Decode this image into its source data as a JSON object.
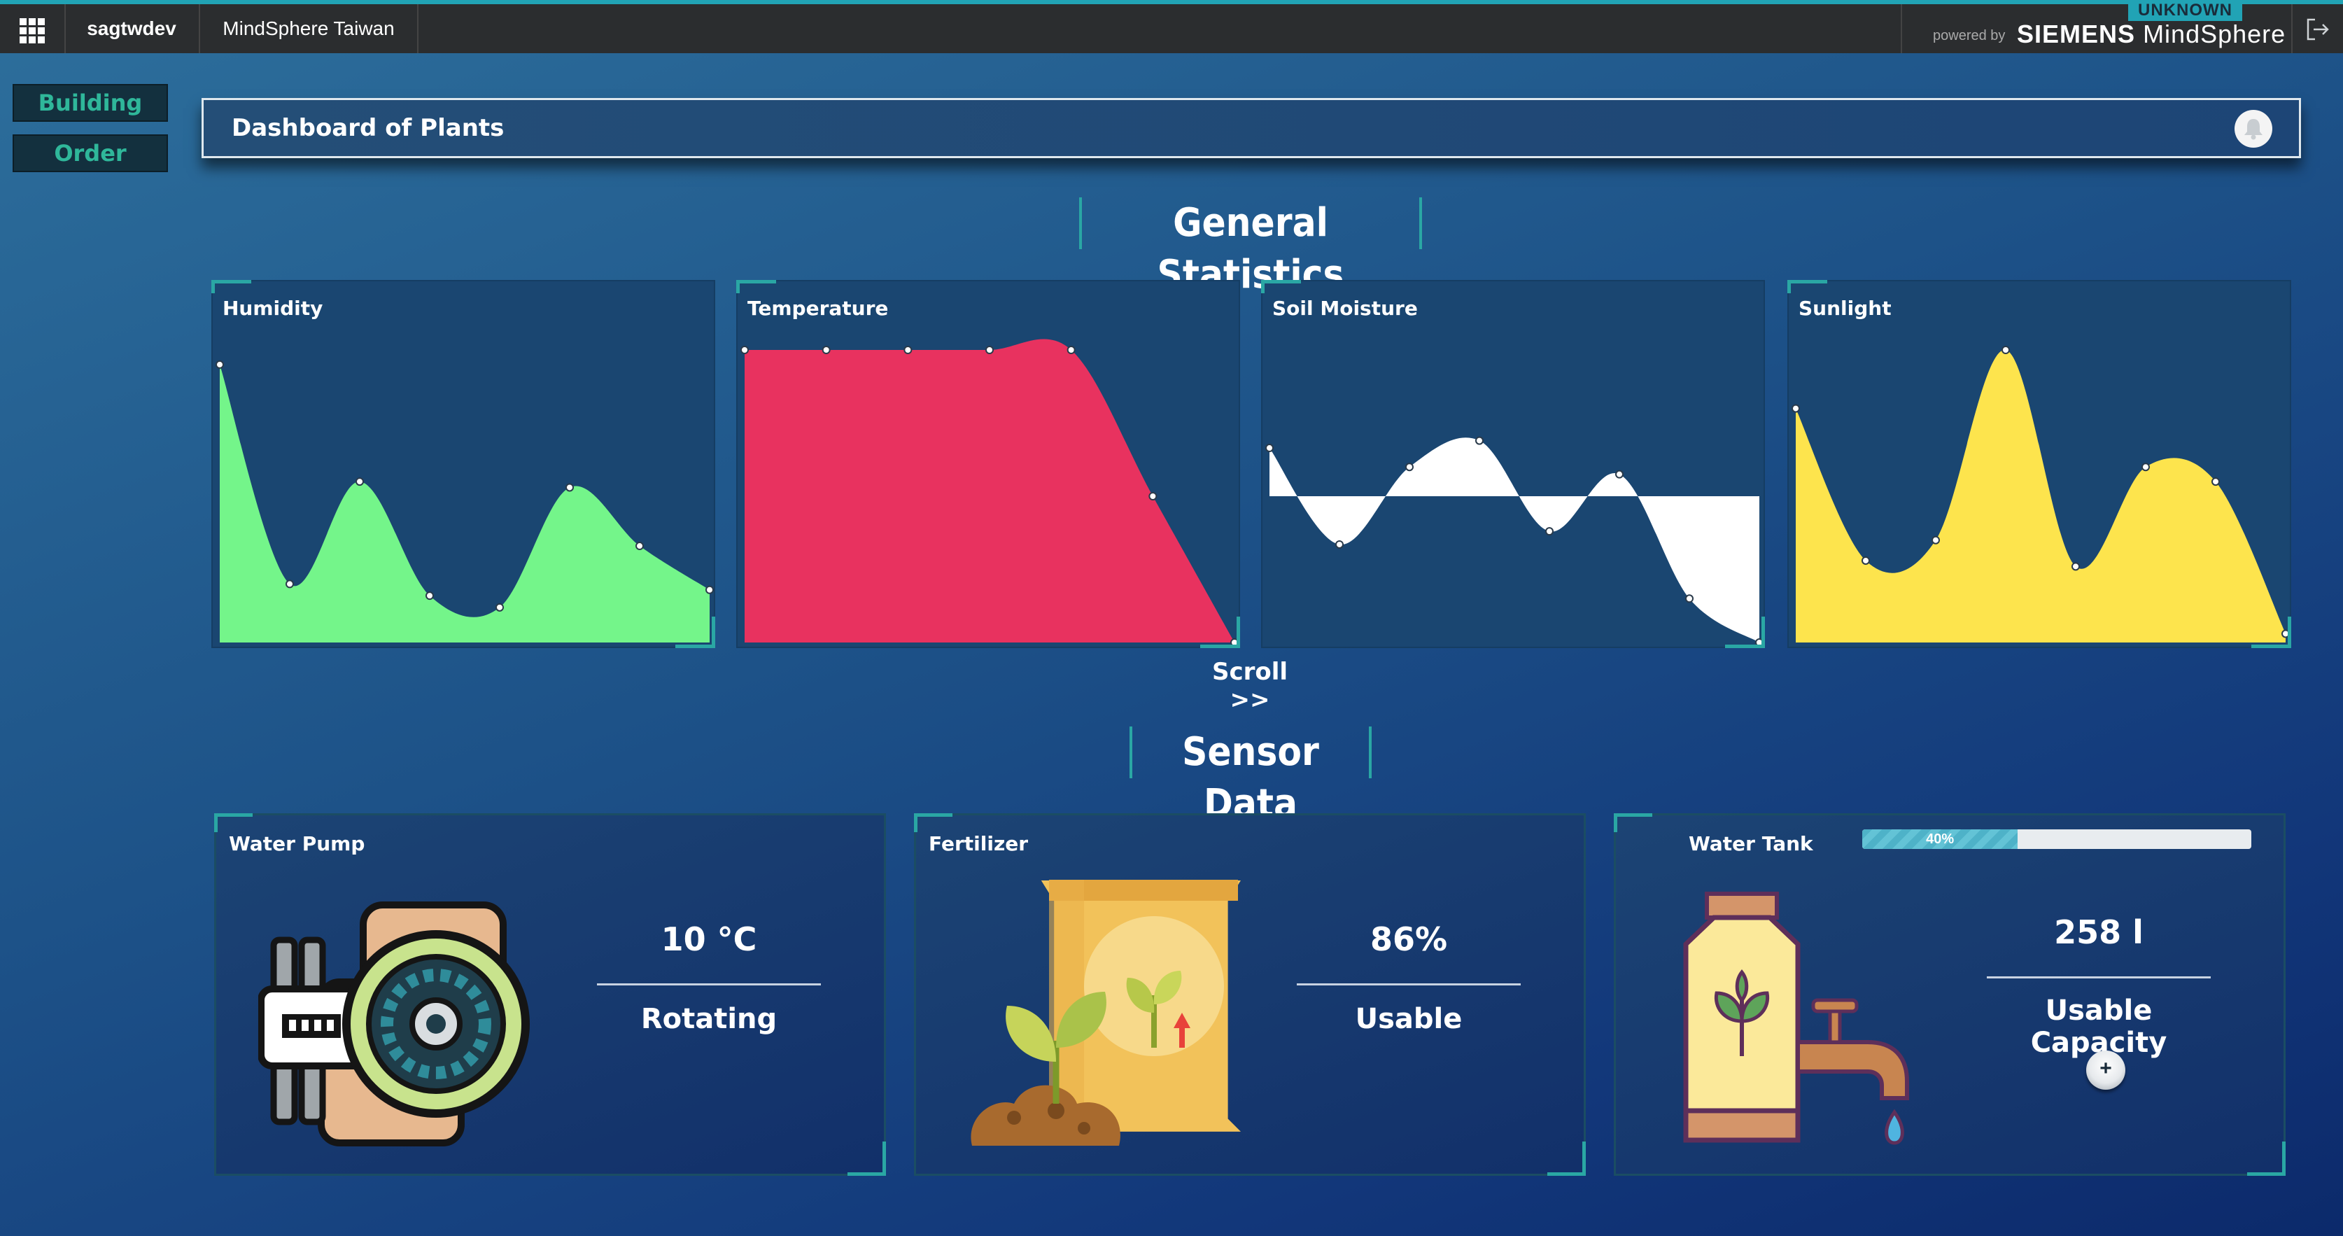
{
  "topbar": {
    "tenant": "sagtwdev",
    "app_name": "MindSphere Taiwan",
    "environment_badge": "UNKNOWN",
    "powered_by": "powered by",
    "brand_siemens": "SIEMENS",
    "brand_product": "MindSphere",
    "accent_color": "#21a3b5"
  },
  "sidebar": {
    "buttons": [
      {
        "label": "Building"
      },
      {
        "label": "Order"
      }
    ]
  },
  "header": {
    "title": "Dashboard of Plants",
    "icon": "bell-icon"
  },
  "general_statistics": {
    "title": "General Statistics",
    "scroll_label": "Scroll >>"
  },
  "chart_data": [
    {
      "type": "area",
      "title": "Humidity",
      "color": "#74f58a",
      "values": [
        0.95,
        0.2,
        0.55,
        0.16,
        0.12,
        0.53,
        0.33,
        0.18
      ],
      "ylim": [
        0,
        1
      ]
    },
    {
      "type": "area",
      "title": "Temperature",
      "color": "#e8325f",
      "values": [
        1.0,
        1.0,
        1.0,
        1.0,
        1.0,
        0.5,
        0.0
      ],
      "ylim": [
        0,
        1
      ]
    },
    {
      "type": "area",
      "title": "Soil Moisture",
      "color": "#ffffff",
      "values": [
        0.33,
        -0.33,
        0.2,
        0.38,
        -0.24,
        0.15,
        -0.7,
        -1.0
      ],
      "ylim": [
        -1,
        1
      ],
      "baseline": 0
    },
    {
      "type": "area",
      "title": "Sunlight",
      "color": "#fde44d",
      "values": [
        0.8,
        0.28,
        0.35,
        1.0,
        0.26,
        0.6,
        0.55,
        0.03
      ],
      "ylim": [
        0,
        1
      ]
    }
  ],
  "sensor_data": {
    "title": "Sensor Data",
    "water_pump": {
      "label": "Water Pump",
      "value": "10 °C",
      "status": "Rotating"
    },
    "fertilizer": {
      "label": "Fertilizer",
      "value": "86%",
      "status": "Usable"
    },
    "water_tank": {
      "label": "Water Tank",
      "progress": 0.4,
      "progress_text": "40%",
      "value": "258 l",
      "status": "Usable Capacity",
      "add_label": "+"
    }
  }
}
